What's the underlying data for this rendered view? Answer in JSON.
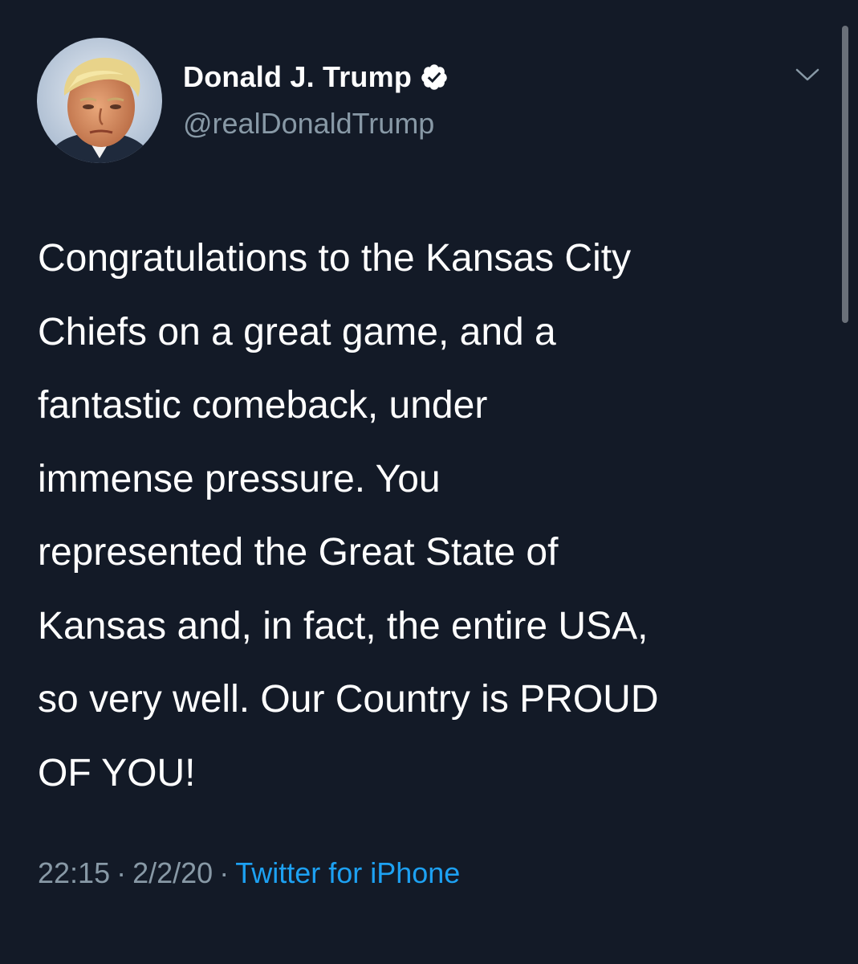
{
  "tweet": {
    "author": {
      "display_name": "Donald J. Trump",
      "handle": "@realDonaldTrump",
      "verified": true,
      "avatar_icon": "profile-photo-avatar"
    },
    "menu_icon": "chevron-down-icon",
    "text_lines": [
      "Congratulations to the Kansas City",
      "Chiefs on a great game, and a",
      "fantastic comeback, under",
      "immense pressure. You",
      "represented the Great State of",
      "Kansas and, in fact, the entire USA,",
      "so very well. Our Country is PROUD",
      "OF YOU!"
    ],
    "meta": {
      "time": "22:15",
      "separator": "·",
      "date": "2/2/20",
      "source": "Twitter for iPhone"
    }
  },
  "colors": {
    "background": "#131a27",
    "text_primary": "#ffffff",
    "text_secondary": "#8899a6",
    "link": "#1da1f2"
  }
}
